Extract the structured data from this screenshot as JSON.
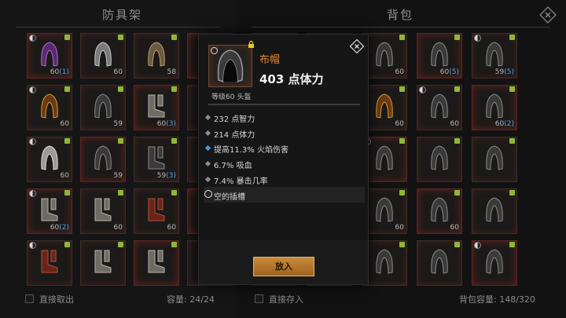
{
  "left_panel": {
    "title": "防具架",
    "take_out_label": "直接取出",
    "capacity_label": "容量: 24/24",
    "slots": [
      {
        "icon": "purple-helmet-icon",
        "level": "60",
        "count": "(1)"
      },
      {
        "icon": "knight-helmet-icon",
        "level": "60",
        "count": ""
      },
      {
        "icon": "scroll-armor-icon",
        "level": "58",
        "count": ""
      },
      {
        "icon": "armor-icon",
        "level": "",
        "count": ""
      },
      {
        "icon": "gold-helmet-icon",
        "level": "60",
        "count": ""
      },
      {
        "icon": "dark-hood-icon",
        "level": "59",
        "count": ""
      },
      {
        "icon": "cloth-boots-icon",
        "level": "60",
        "count": "(3)"
      },
      {
        "icon": "armor-icon",
        "level": "",
        "count": ""
      },
      {
        "icon": "white-hood-icon",
        "level": "60",
        "count": ""
      },
      {
        "icon": "dark-hood-icon",
        "level": "59",
        "count": ""
      },
      {
        "icon": "dark-boots-icon",
        "level": "59",
        "count": "(3)"
      },
      {
        "icon": "armor-icon",
        "level": "",
        "count": ""
      },
      {
        "icon": "cloth-boots-icon",
        "level": "60",
        "count": "(2)"
      },
      {
        "icon": "leather-boots-icon",
        "level": "60",
        "count": ""
      },
      {
        "icon": "red-gloves-icon",
        "level": "60",
        "count": ""
      },
      {
        "icon": "armor-icon",
        "level": "",
        "count": ""
      },
      {
        "icon": "red-boots-icon",
        "level": "",
        "count": ""
      },
      {
        "icon": "cloth-boots-icon",
        "level": "",
        "count": ""
      },
      {
        "icon": "cloth-gloves-icon",
        "level": "",
        "count": ""
      },
      {
        "icon": "armor-icon",
        "level": "",
        "count": ""
      }
    ]
  },
  "right_panel": {
    "title": "背包",
    "store_label": "直接存入",
    "capacity_label": "背包容量: 148/320",
    "slots": [
      {
        "icon": "dark-hood-icon",
        "level": "60",
        "count": "(5)"
      },
      {
        "icon": "dark-hood-icon",
        "level": "60",
        "count": "(5)"
      },
      {
        "icon": "dark-hood-icon",
        "level": "60",
        "count": ""
      },
      {
        "icon": "dark-hood-icon",
        "level": "60",
        "count": "(5)"
      },
      {
        "icon": "dark-hood-icon",
        "level": "59",
        "count": "(5)"
      },
      {
        "icon": "masked-helmet-icon",
        "level": "60",
        "count": "(5)"
      },
      {
        "icon": "horned-helmet-icon",
        "level": "",
        "count": ""
      },
      {
        "icon": "red-gold-helmet-icon",
        "level": "60",
        "count": ""
      },
      {
        "icon": "dark-hood-icon",
        "level": "60",
        "count": ""
      },
      {
        "icon": "dark-hood-icon",
        "level": "60",
        "count": "(2)"
      },
      {
        "icon": "dark-hood-icon",
        "level": "60",
        "count": "(1)"
      },
      {
        "icon": "dark-hood-icon",
        "level": "",
        "count": ""
      },
      {
        "icon": "dark-hood-icon",
        "level": "",
        "count": ""
      },
      {
        "icon": "dark-hood-icon",
        "level": "",
        "count": ""
      },
      {
        "icon": "dark-hood-icon",
        "level": "",
        "count": ""
      },
      {
        "icon": "dark-hood-icon",
        "level": "",
        "count": ""
      },
      {
        "icon": "dark-hood-icon",
        "level": "60",
        "count": "(4)"
      },
      {
        "icon": "dark-hood-icon",
        "level": "60",
        "count": ""
      },
      {
        "icon": "dark-hood-icon",
        "level": "60",
        "count": ""
      },
      {
        "icon": "dark-hood-icon",
        "level": "",
        "count": ""
      },
      {
        "icon": "dark-hood-icon",
        "level": "",
        "count": ""
      },
      {
        "icon": "dark-hood-icon",
        "level": "",
        "count": ""
      },
      {
        "icon": "dark-hood-icon",
        "level": "",
        "count": ""
      },
      {
        "icon": "dark-hood-icon",
        "level": "",
        "count": ""
      },
      {
        "icon": "dark-hood-icon",
        "level": "",
        "count": ""
      }
    ]
  },
  "tooltip": {
    "item_icon": "cloth-hood-icon",
    "item_name": "布帽",
    "main_stat": "403 点体力",
    "subtitle": "等级60 头盔",
    "stats": [
      {
        "text": "232 点智力",
        "type": "normal"
      },
      {
        "text": "214 点体力",
        "type": "normal"
      },
      {
        "text": "提高11.3% 火焰伤害",
        "type": "blue"
      },
      {
        "text": "6.7% 吸血",
        "type": "normal"
      },
      {
        "text": "7.4% 暴击几率",
        "type": "normal"
      }
    ],
    "socket_text": "空的插槽",
    "put_button": "放入"
  },
  "colors": {
    "item_name": "#e8882f",
    "button": "#c88a3a",
    "count_blue": "#4fa3e0",
    "magic_stat": "#4e9be6"
  }
}
